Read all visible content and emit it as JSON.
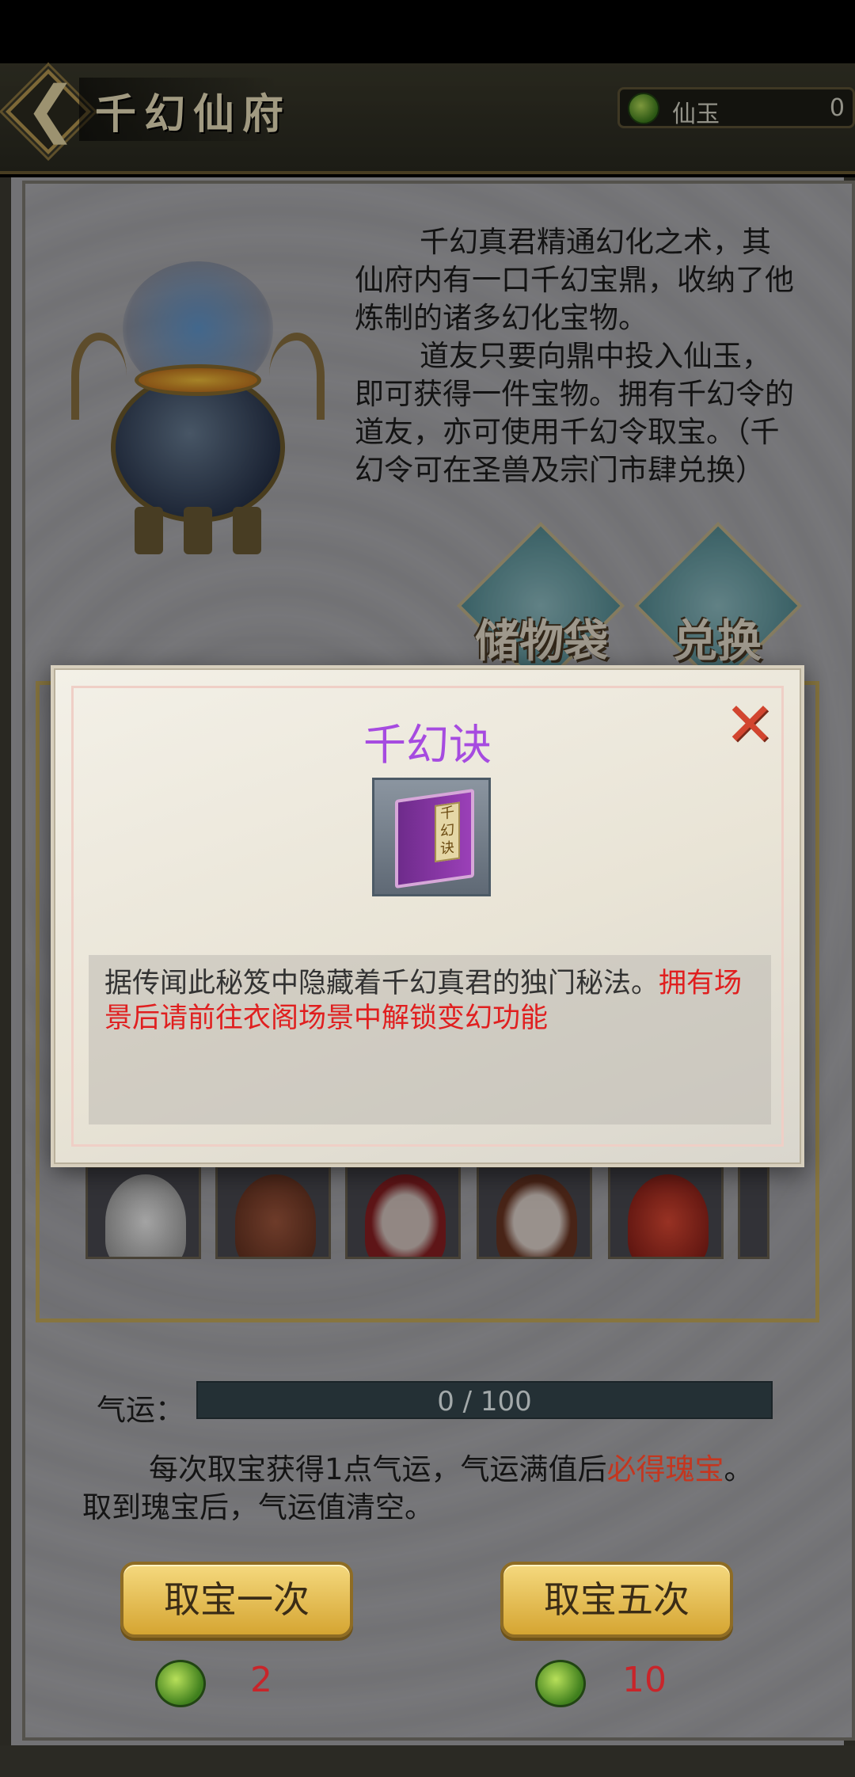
{
  "header": {
    "back_icon": "chevron-left-icon",
    "title": "千幻仙府",
    "currency": {
      "icon": "jade-icon",
      "label": "仙玉",
      "value": "0"
    }
  },
  "intro": {
    "paragraph1": "千幻真君精通幻化之术，其仙府内有一口千幻宝鼎，收纳了他炼制的诸多幻化宝物。",
    "paragraph2": "道友只要向鼎中投入仙玉，即可获得一件宝物。拥有千幻令的道友，亦可使用千幻令取宝。（千幻令可在圣兽及宗门市肆兑换）"
  },
  "side_buttons": {
    "storage_label": "储物袋",
    "exchange_label": "兑换"
  },
  "dialog": {
    "title": "千幻诀",
    "book_label": "千幻诀",
    "description_black": "据传闻此秘笈中隐藏着千幻真君的独门秘法。",
    "description_red": "拥有场景后请前往衣阁场景中解锁变幻功能",
    "title_color": "#a64be0",
    "highlight_color": "#e01f1f"
  },
  "luck": {
    "label": "气运：",
    "text": "0 / 100",
    "current": 0,
    "max": 100
  },
  "rule": {
    "part1": "每次取宝获得1点气运，气运满值后",
    "part2_red": "必得瑰宝",
    "part3": "。取到瑰宝后，气运值清空。"
  },
  "draw_once": {
    "label": "取宝一次",
    "cost": "2"
  },
  "draw_five": {
    "label": "取宝五次",
    "cost": "10"
  }
}
